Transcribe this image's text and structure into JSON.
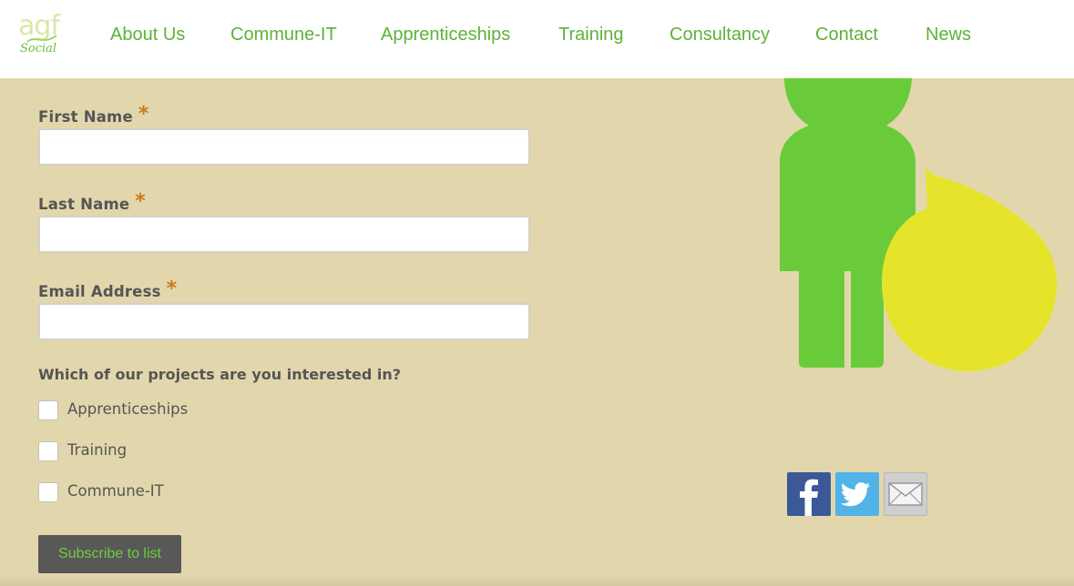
{
  "brand": {
    "logo_top": "agf",
    "logo_bottom": "Social",
    "accent_color": "#5cb338",
    "background_color": "#e2d7ac"
  },
  "nav": {
    "items": [
      "About Us",
      "Commune-IT",
      "Apprenticeships",
      "Training",
      "Consultancy",
      "Contact",
      "News"
    ]
  },
  "form": {
    "first_name_label": "First Name",
    "last_name_label": "Last Name",
    "email_label": "Email Address",
    "required_marker": "*",
    "first_name_value": "",
    "last_name_value": "",
    "email_value": "",
    "question": "Which of our projects are you interested in?",
    "options": [
      "Apprenticeships",
      "Training",
      "Commune-IT"
    ],
    "submit_label": "Subscribe to list"
  },
  "illustration": {
    "icon": "person-speech-bubble-icon",
    "person_color": "#6acb3a",
    "bubble_color": "#e6e32b"
  },
  "social": {
    "icons": [
      "facebook-icon",
      "twitter-icon",
      "email-icon"
    ]
  }
}
